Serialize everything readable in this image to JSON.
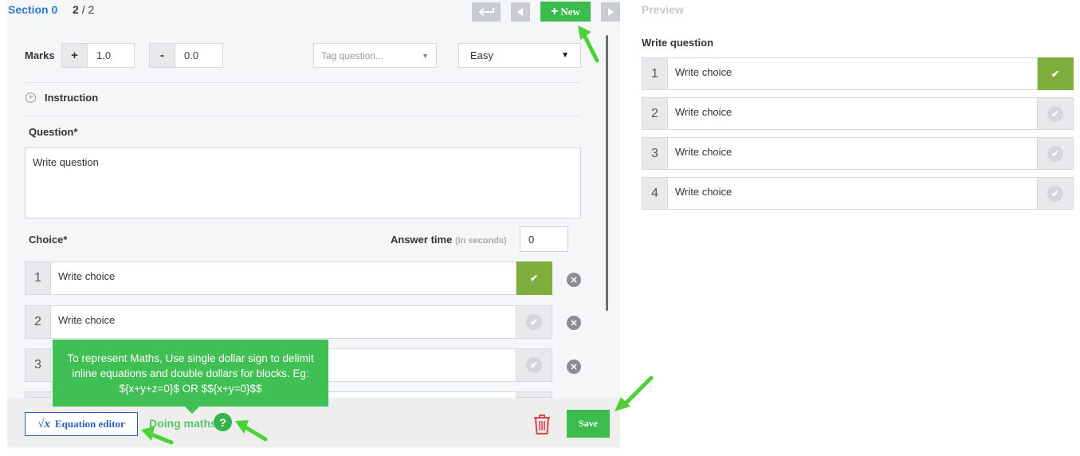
{
  "header": {
    "section_title": "Section 0",
    "page_current": "2",
    "page_separator": "/",
    "page_total": "2",
    "new_button": "New",
    "new_plus": "+",
    "back_icon": "return-arrow-icon",
    "prev_icon": "triangle-left-icon",
    "next_icon": "triangle-right-icon"
  },
  "marks": {
    "label": "Marks",
    "positive_sign": "+",
    "positive_value": "1.0",
    "negative_sign": "-",
    "negative_value": "0.0"
  },
  "tag": {
    "placeholder": "Tag question...",
    "caret": "▼"
  },
  "difficulty": {
    "selected": "Easy",
    "caret": "▼"
  },
  "instruction": {
    "label": "Instruction",
    "icon_glyph": "+"
  },
  "question": {
    "label": "Question*",
    "value": "Write question"
  },
  "choices": {
    "label": "Choice*",
    "answer_time_label": "Answer time",
    "answer_time_hint": "(in seconds)",
    "answer_time_value": "0",
    "items": [
      {
        "num": "1",
        "text": "Write choice",
        "correct": true
      },
      {
        "num": "2",
        "text": "Write choice",
        "correct": false
      },
      {
        "num": "3",
        "text": "",
        "correct": false
      }
    ],
    "check_glyph": "✔",
    "remove_glyph": "✕"
  },
  "tooltip": {
    "text": "To represent Maths, Use single dollar sign to delimit inline equations and double dollars for blocks. Eg: ${x+y+z=0}$ OR $${x+y=0}$$"
  },
  "footer": {
    "equation_editor": "Equation editor",
    "sqrt_glyph": "√x",
    "doing_maths": "Doing maths",
    "help_glyph": "?",
    "save": "Save"
  },
  "preview": {
    "label": "Preview",
    "question": "Write question",
    "items": [
      {
        "num": "1",
        "text": "Write choice",
        "correct": true
      },
      {
        "num": "2",
        "text": "Write choice",
        "correct": false
      },
      {
        "num": "3",
        "text": "Write choice",
        "correct": false
      },
      {
        "num": "4",
        "text": "Write choice",
        "correct": false
      }
    ]
  },
  "colors": {
    "accent_green": "#3cbc4e",
    "correct_green": "#7fae3d",
    "link_blue": "#2e7bd0",
    "delete_red": "#e0424b"
  }
}
